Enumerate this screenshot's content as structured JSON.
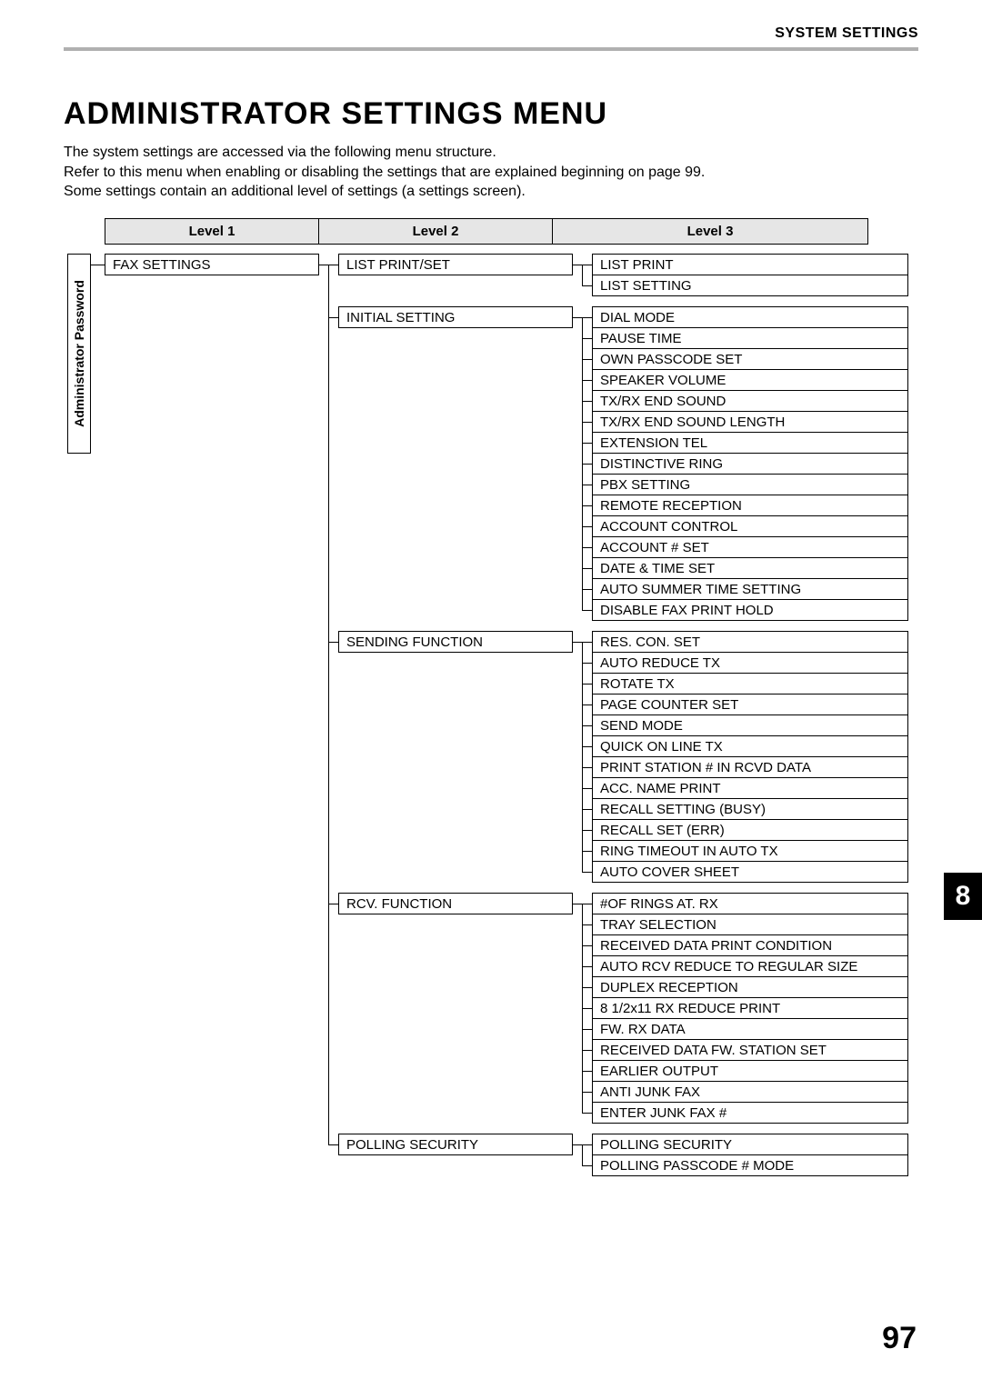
{
  "header": "SYSTEM SETTINGS",
  "title": "ADMINISTRATOR SETTINGS MENU",
  "intro": [
    "The system settings are accessed via the following menu structure.",
    "Refer to this menu when enabling or disabling the settings that are explained beginning on page 99.",
    "Some settings contain an additional level of settings (a settings screen)."
  ],
  "levels": {
    "l1": "Level 1",
    "l2": "Level 2",
    "l3": "Level 3"
  },
  "admin_pw": "Administrator Password",
  "level1": "FAX SETTINGS",
  "groups": [
    {
      "l2": "LIST PRINT/SET",
      "l3": [
        "LIST PRINT",
        "LIST SETTING"
      ]
    },
    {
      "l2": "INITIAL SETTING",
      "l3": [
        "DIAL MODE",
        "PAUSE TIME",
        "OWN PASSCODE SET",
        "SPEAKER VOLUME",
        "TX/RX END SOUND",
        "TX/RX END SOUND LENGTH",
        "EXTENSION TEL",
        "DISTINCTIVE RING",
        "PBX SETTING",
        "REMOTE RECEPTION",
        "ACCOUNT CONTROL",
        "ACCOUNT # SET",
        "DATE & TIME SET",
        "AUTO SUMMER TIME SETTING",
        "DISABLE FAX PRINT HOLD"
      ]
    },
    {
      "l2": "SENDING FUNCTION",
      "l3": [
        "RES. CON. SET",
        "AUTO REDUCE TX",
        "ROTATE TX",
        "PAGE COUNTER SET",
        "SEND MODE",
        "QUICK ON LINE TX",
        "PRINT STATION # IN RCVD DATA",
        "ACC. NAME PRINT",
        "RECALL SETTING (BUSY)",
        "RECALL SET (ERR)",
        "RING TIMEOUT IN AUTO TX",
        "AUTO COVER SHEET"
      ]
    },
    {
      "l2": "RCV. FUNCTION",
      "l3": [
        "#OF RINGS AT. RX",
        "TRAY SELECTION",
        "RECEIVED DATA PRINT CONDITION",
        "AUTO RCV REDUCE TO REGULAR SIZE",
        "DUPLEX RECEPTION",
        "8 1/2x11 RX REDUCE PRINT",
        "FW. RX DATA",
        "RECEIVED DATA FW. STATION SET",
        "EARLIER OUTPUT",
        "ANTI JUNK FAX",
        "ENTER JUNK FAX #"
      ]
    },
    {
      "l2": "POLLING SECURITY",
      "l3": [
        "POLLING SECURITY",
        "POLLING PASSCODE # MODE"
      ]
    }
  ],
  "chapter_tab": "8",
  "page_number": "97"
}
